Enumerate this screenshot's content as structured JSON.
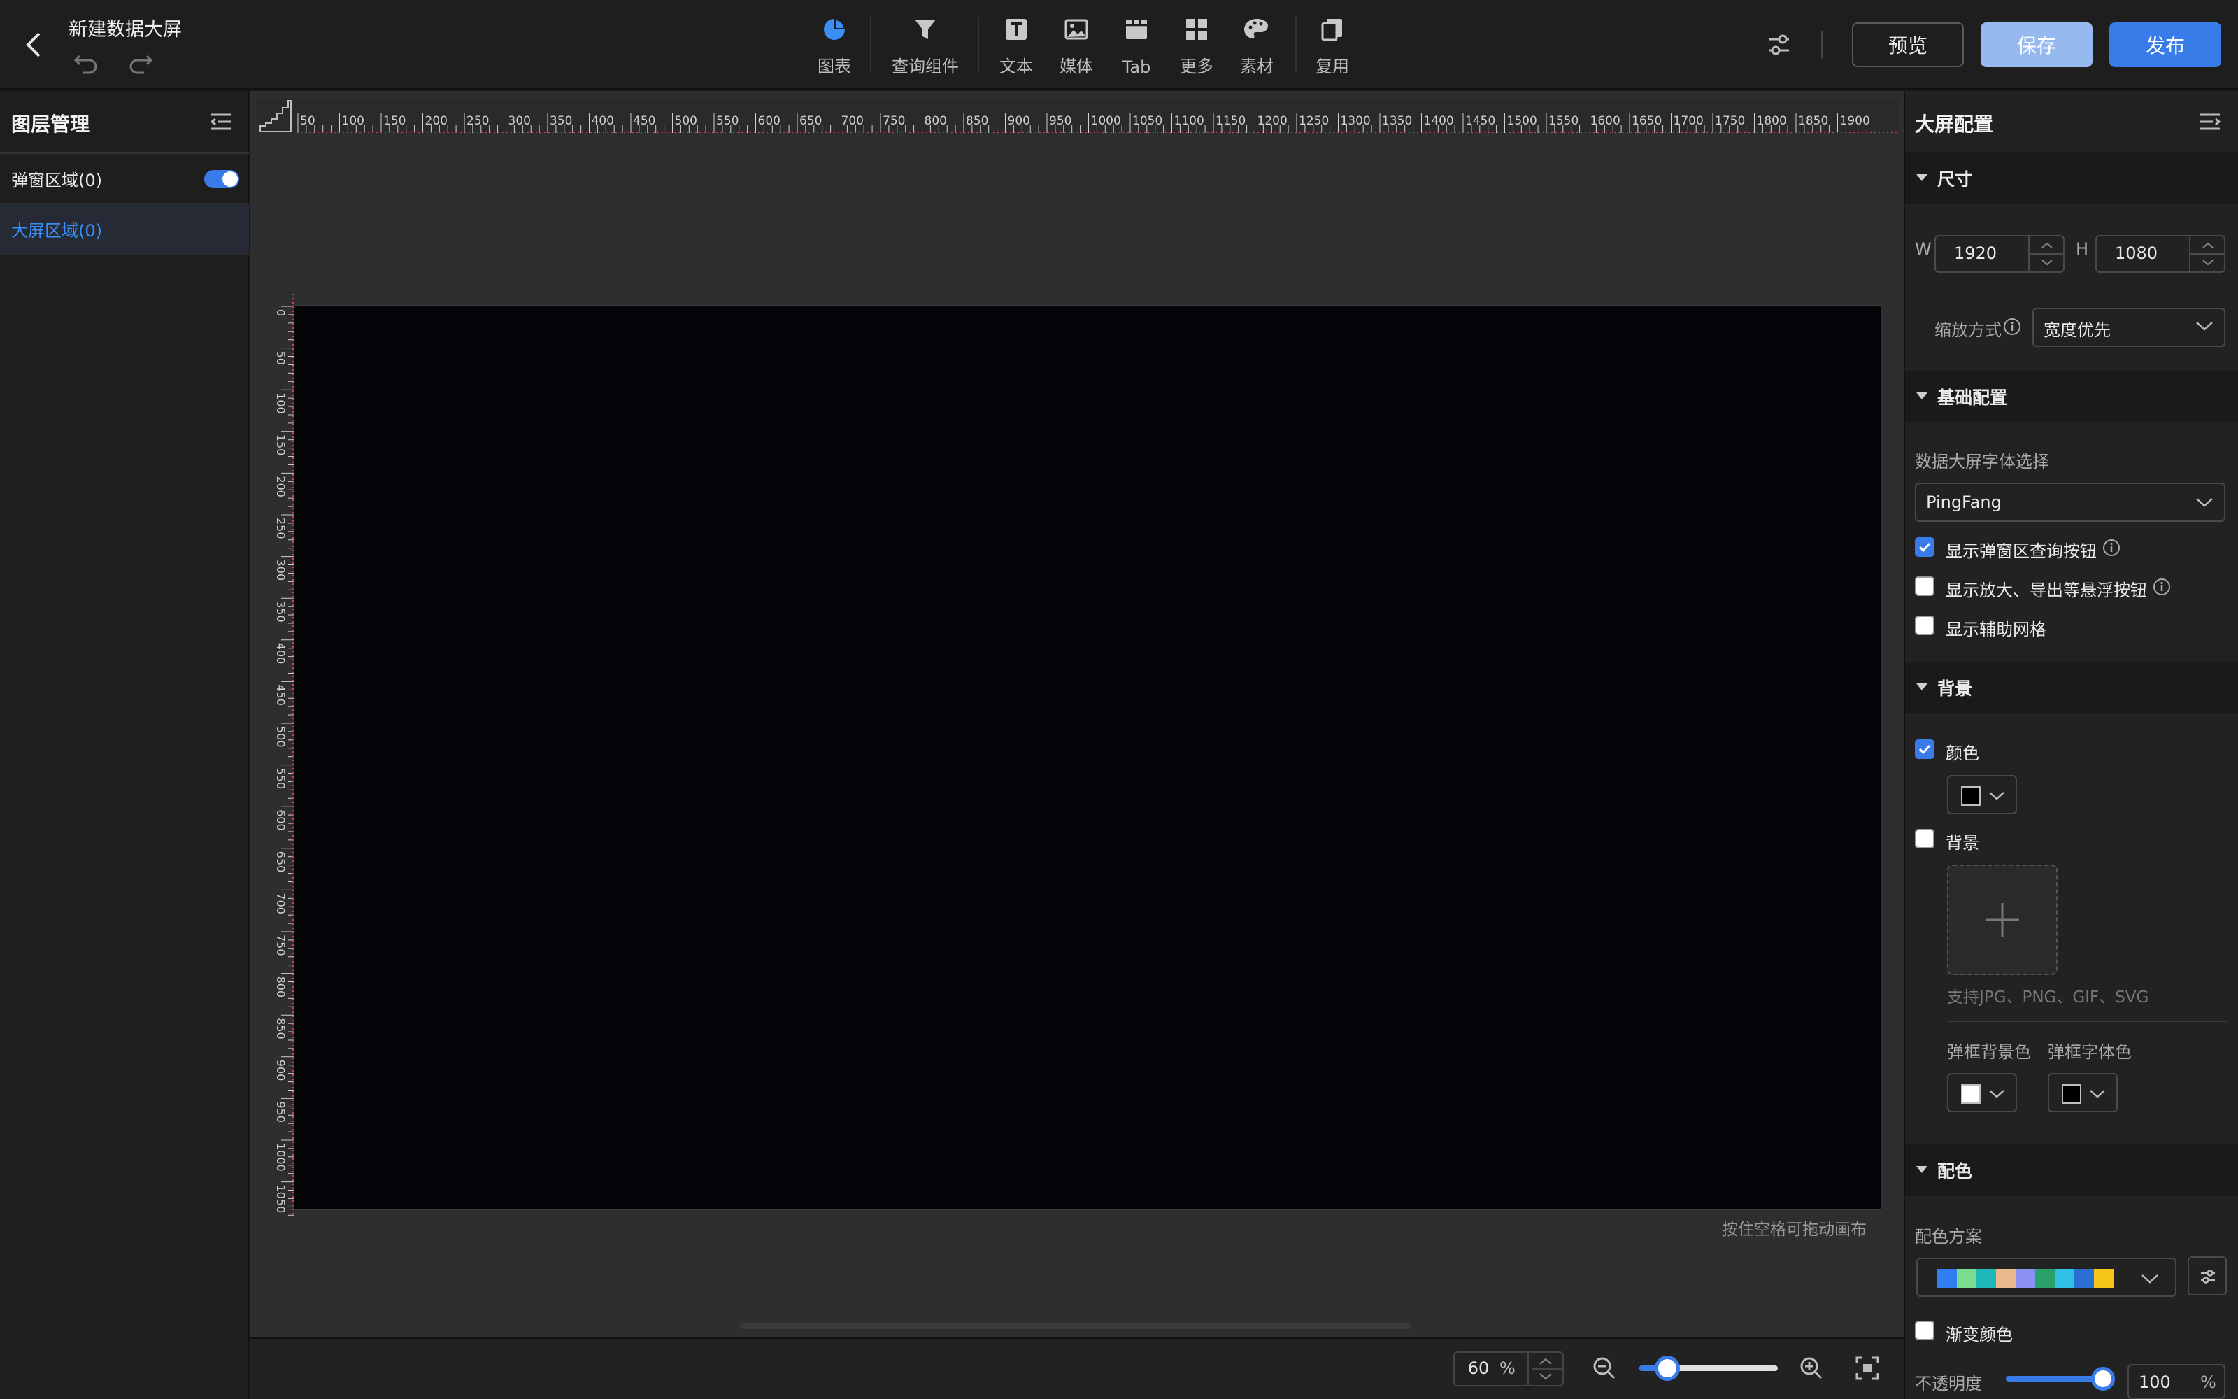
{
  "topbar": {
    "title": "新建数据大屏",
    "tools": [
      {
        "label": "图表",
        "icon": "chart-pie-icon",
        "color": "#3a8ff5"
      },
      {
        "label": "查询组件",
        "icon": "filter-icon"
      },
      {
        "label": "文本",
        "icon": "text-icon"
      },
      {
        "label": "媒体",
        "icon": "image-icon"
      },
      {
        "label": "Tab",
        "icon": "tab-icon"
      },
      {
        "label": "更多",
        "icon": "grid-icon"
      },
      {
        "label": "素材",
        "icon": "palette-icon"
      },
      {
        "label": "复用",
        "icon": "copy-icon"
      }
    ],
    "preview_label": "预览",
    "save_label": "保存",
    "publish_label": "发布"
  },
  "layers": {
    "title": "图层管理",
    "popup_area": "弹窗区域(0)",
    "popup_enabled": true,
    "screen_area": "大屏区域(0)"
  },
  "canvas": {
    "ruler_top_ticks": [
      "50",
      "100",
      "150",
      "200",
      "250",
      "300",
      "350",
      "400",
      "450",
      "500",
      "550",
      "600",
      "650",
      "700",
      "750",
      "800",
      "850",
      "900",
      "950",
      "1000",
      "1050",
      "1100",
      "1150",
      "1200",
      "1250",
      "1300",
      "1350",
      "1400",
      "1450",
      "1500",
      "1550",
      "1600",
      "1650",
      "1700",
      "1750",
      "1800",
      "1850",
      "1900"
    ],
    "ruler_left_ticks": [
      "0",
      "50",
      "100",
      "150",
      "200",
      "250",
      "300",
      "350",
      "400",
      "450",
      "500",
      "550",
      "600",
      "650",
      "700",
      "750",
      "800",
      "850",
      "900",
      "950",
      "1000",
      "1050"
    ],
    "drag_hint": "按住空格可拖动画布"
  },
  "zoom": {
    "value": "60",
    "unit": "%",
    "level": 0.2
  },
  "config": {
    "title": "大屏配置",
    "size": {
      "section": "尺寸",
      "w_label": "W",
      "w_value": "1920",
      "h_label": "H",
      "h_value": "1080",
      "scale_label": "缩放方式",
      "scale_value": "宽度优先"
    },
    "basic": {
      "section": "基础配置",
      "font_label": "数据大屏字体选择",
      "font_value": "PingFang",
      "show_popup_query": "显示弹窗区查询按钮",
      "show_popup_query_checked": true,
      "show_float_buttons": "显示放大、导出等悬浮按钮",
      "show_float_buttons_checked": false,
      "show_grid": "显示辅助网格",
      "show_grid_checked": false
    },
    "background": {
      "section": "背景",
      "color_label": "颜色",
      "color_checked": true,
      "color_value": "#000000",
      "image_label": "背景",
      "image_checked": false,
      "upload_hint": "支持JPG、PNG、GIF、SVG",
      "popup_bg_label": "弹框背景色",
      "popup_bg_color": "#ffffff",
      "popup_font_label": "弹框字体色",
      "popup_font_color": "#000000"
    },
    "colors": {
      "section": "配色",
      "scheme_label": "配色方案",
      "scheme": [
        "#2f7ff0",
        "#7bdc8f",
        "#1fb8b8",
        "#e8b98a",
        "#8a8ff0",
        "#2aa06a",
        "#2fc0e8",
        "#2a6fd6",
        "#f5c518"
      ],
      "gradient_label": "渐变颜色",
      "gradient_checked": false,
      "opacity_label": "不透明度",
      "opacity_value": "100",
      "opacity_unit": "%"
    }
  }
}
